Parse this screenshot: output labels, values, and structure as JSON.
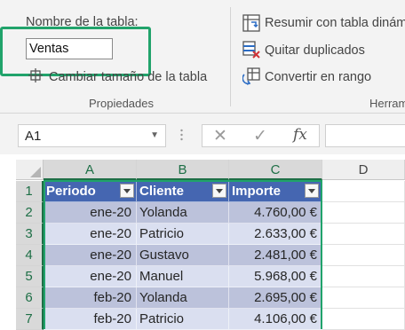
{
  "ribbon": {
    "table_name_label": "Nombre de la tabla:",
    "table_name_value": "Ventas",
    "resize_label": "Cambiar tamaño de la tabla",
    "properties_group": "Propiedades",
    "summarize_label": "Resumir con tabla dinám",
    "remove_duplicates_label": "Quitar duplicados",
    "convert_range_label": "Convertir en rango",
    "tools_group": "Herram",
    "highlight_color": "#21a36b"
  },
  "formula_bar": {
    "name_box": "A1",
    "cancel_icon": "✕",
    "enter_icon": "✓",
    "fx_icon": "fx"
  },
  "grid": {
    "columns": [
      "A",
      "B",
      "C",
      "D"
    ],
    "rows": [
      "1",
      "2",
      "3",
      "4",
      "5",
      "6",
      "7"
    ],
    "header": [
      "Periodo",
      "Cliente",
      "Importe"
    ],
    "data": [
      [
        "ene-20",
        "Yolanda",
        "4.760,00 €"
      ],
      [
        "ene-20",
        "Patricio",
        "2.633,00 €"
      ],
      [
        "ene-20",
        "Gustavo",
        "2.481,00 €"
      ],
      [
        "ene-20",
        "Manuel",
        "5.968,00 €"
      ],
      [
        "feb-20",
        "Yolanda",
        "2.695,00 €"
      ],
      [
        "feb-20",
        "Patricio",
        "4.106,00 €"
      ]
    ],
    "header_color": "#4566b1",
    "band_dark_color": "#bcc2db",
    "band_light_color": "#dadff0"
  }
}
